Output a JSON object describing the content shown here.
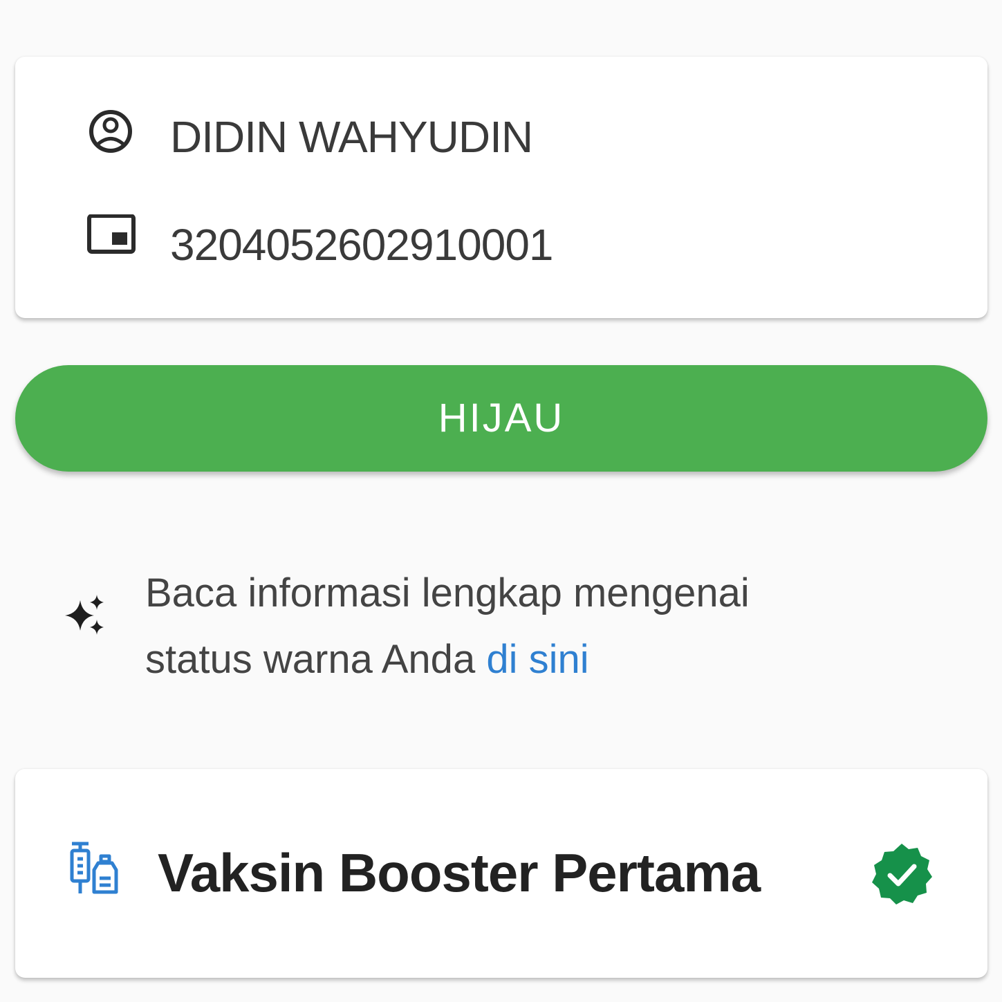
{
  "profile": {
    "name": "DIDIN WAHYUDIN",
    "nik": "3204052602910001",
    "icons": {
      "name": "account-circle-icon",
      "nik": "id-card-icon"
    }
  },
  "status": {
    "label": "HIJAU",
    "color": "#4caf50"
  },
  "info": {
    "line1": "Baca informasi lengkap mengenai",
    "line2_prefix": "status warna Anda ",
    "link_text": "di sini",
    "link_color": "#2f80d1",
    "icon": "sparkles-icon"
  },
  "vaccine": {
    "title": "Vaksin Booster Pertama",
    "icon": "syringe-vial-icon",
    "status_icon": "verified-check-badge-icon",
    "status_color": "#16914a"
  }
}
